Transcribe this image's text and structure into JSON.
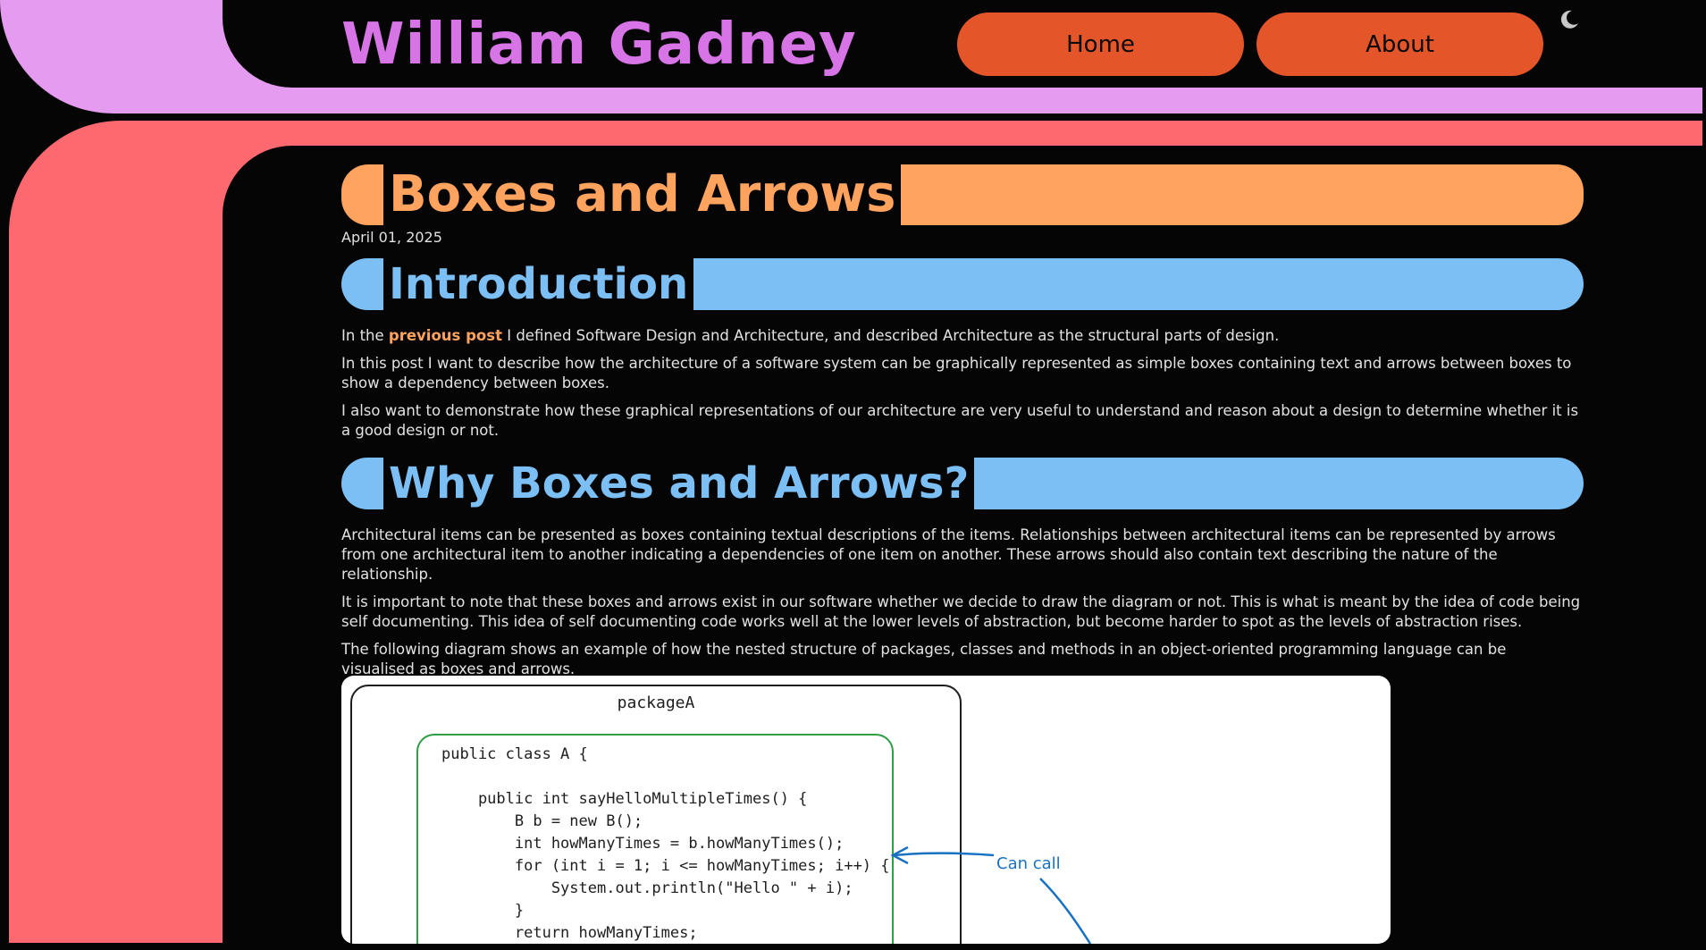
{
  "header": {
    "site_title": "William Gadney",
    "nav": {
      "home": "Home",
      "about": "About"
    },
    "theme_icon": "moon-icon",
    "theme_glyph": "☾"
  },
  "colors": {
    "pink": "#e59bef",
    "red": "#fe6970",
    "orange": "#ffa35e",
    "blue": "#7bbff5",
    "nav_button": "#e4552a",
    "title": "#d774e6"
  },
  "post": {
    "title": "Boxes and Arrows",
    "date": "April 01, 2025",
    "sections": [
      {
        "heading": "Introduction",
        "paragraphs": {
          "p1_before": "In the ",
          "p1_link": "previous post",
          "p1_after": " I defined Software Design and Architecture, and described Architecture as the structural parts of design.",
          "p2": "In this post I want to describe how the architecture of a software system can be graphically represented as simple boxes containing text and arrows between boxes to show a dependency between boxes.",
          "p3": "I also want to demonstrate how these graphical representations of our architecture are very useful to understand and reason about a design to determine whether it is a good design or not."
        }
      },
      {
        "heading": "Why Boxes and Arrows?",
        "paragraphs": {
          "p1": "Architectural items can be presented as boxes containing textual descriptions of the items. Relationships between architectural items can be represented by arrows from one architectural item to another indicating a dependencies of one item on another. These arrows should also contain text describing the nature of the relationship.",
          "p2": "It is important to note that these boxes and arrows exist in our software whether we decide to draw the diagram or not. This is what is meant by the idea of code being self documenting. This idea of self documenting code works well at the lower levels of abstraction, but become harder to spot as the levels of abstraction rises.",
          "p3": "The following diagram shows an example of how the nested structure of packages, classes and methods in an object-oriented programming language can be visualised as boxes and arrows."
        }
      }
    ]
  },
  "diagram": {
    "package_label": "packageA",
    "code_lines": "public class A {\n\n    public int sayHelloMultipleTimes() {\n        B b = new B();\n        int howManyTimes = b.howManyTimes();\n        for (int i = 1; i <= howManyTimes; i++) {\n            System.out.println(\"Hello \" + i);\n        }\n        return howManyTimes;",
    "arrow_label": "Can call"
  }
}
